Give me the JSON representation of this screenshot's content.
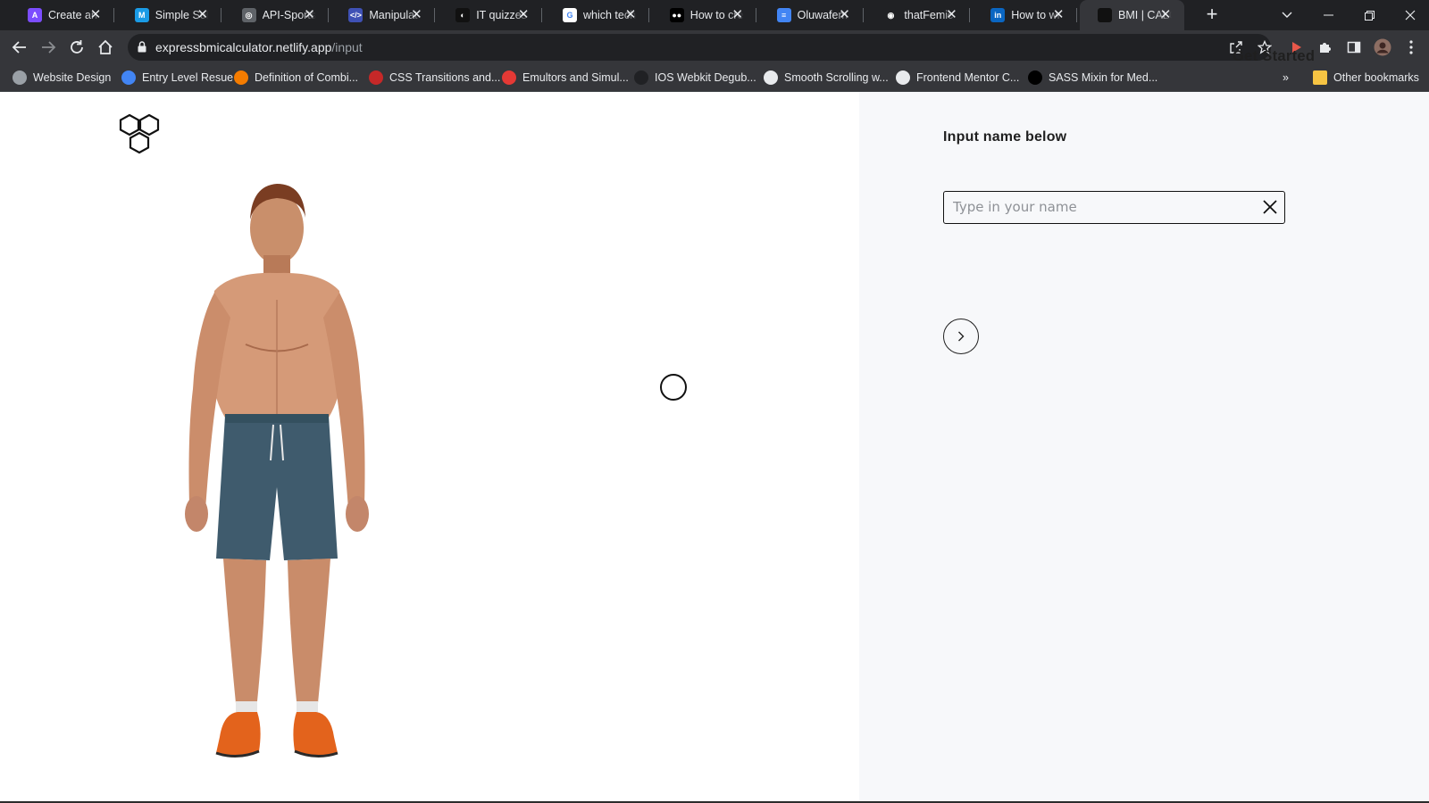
{
  "browser": {
    "tabs": [
      {
        "title": "Create an",
        "favicon_color": "#7c4dff",
        "favicon_glyph": "A",
        "icon": "app-icon"
      },
      {
        "title": "Simple Sol",
        "favicon_color": "#1a9be6",
        "favicon_glyph": "M",
        "icon": "app-icon"
      },
      {
        "title": "API-Sports",
        "favicon_color": "#5f6368",
        "favicon_glyph": "◎",
        "icon": "globe-icon"
      },
      {
        "title": "Manipulat",
        "favicon_color": "#3f51b5",
        "favicon_glyph": "</>",
        "icon": "code-icon"
      },
      {
        "title": "IT quizzes",
        "favicon_color": "#111111",
        "favicon_glyph": "◐",
        "icon": "quiz-icon"
      },
      {
        "title": "which tech",
        "favicon_color": "#ffffff",
        "favicon_glyph": "G",
        "icon": "google-icon"
      },
      {
        "title": "How to cre",
        "favicon_color": "#000000",
        "favicon_glyph": "●●",
        "icon": "medium-icon"
      },
      {
        "title": "Oluwafem",
        "favicon_color": "#4285f4",
        "favicon_glyph": "≡",
        "icon": "docs-icon"
      },
      {
        "title": "thatFemic",
        "favicon_color": "#202124",
        "favicon_glyph": "◉",
        "icon": "github-icon"
      },
      {
        "title": "How to wr",
        "favicon_color": "#0a66c2",
        "favicon_glyph": "in",
        "icon": "linkedin-icon"
      },
      {
        "title": "BMI | CALC",
        "favicon_color": "#111111",
        "favicon_glyph": "",
        "icon": "site-icon",
        "active": true
      }
    ],
    "tab_close_glyph": "✕",
    "new_tab_glyph": "+",
    "url_host": "expressbmicalculator.netlify.app",
    "url_path": "/input",
    "bookmarks": [
      {
        "label": "Website Design",
        "color": "#9aa0a6"
      },
      {
        "label": "Entry Level Resue",
        "color": "#4285f4"
      },
      {
        "label": "Definition of Combi...",
        "color": "#f57c00"
      },
      {
        "label": "CSS Transitions and...",
        "color": "#c62828"
      },
      {
        "label": "Emultors and Simul...",
        "color": "#e53935"
      },
      {
        "label": "IOS Webkit Degub...",
        "color": "#202124"
      },
      {
        "label": "Smooth Scrolling w...",
        "color": "#e8eaed"
      },
      {
        "label": "Frontend Mentor C...",
        "color": "#e8eaed"
      },
      {
        "label": "SASS Mixin for Med...",
        "color": "#000000"
      }
    ],
    "overflow_glyph": "»",
    "other_bookmarks": "Other bookmarks"
  },
  "page": {
    "nav": {
      "get_started": "Get Started"
    },
    "form": {
      "label": "Input name below",
      "placeholder": "Type in your name",
      "value": ""
    },
    "colors": {
      "right_bg": "#f7f8fa",
      "text": "#1f1f1f"
    }
  }
}
